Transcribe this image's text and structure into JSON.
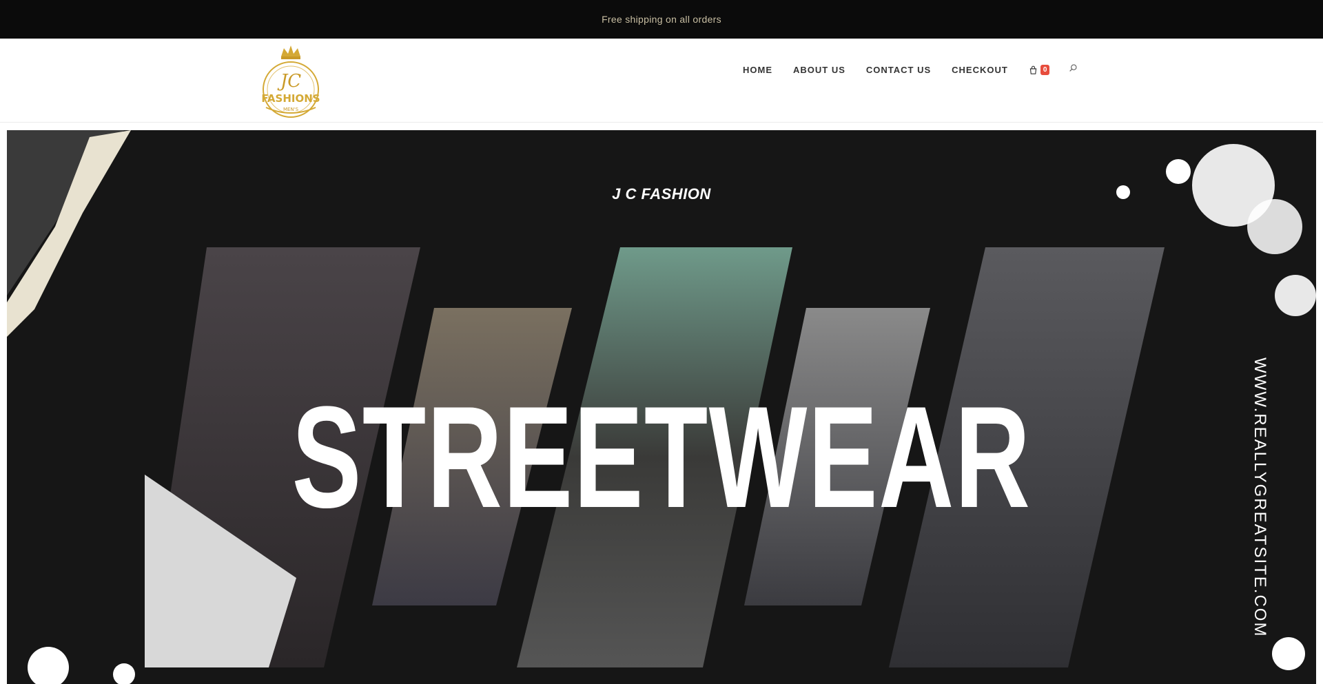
{
  "topbar": {
    "text": "Free shipping on all orders"
  },
  "header": {
    "logo": {
      "main": "FASHIONS",
      "sub": "MEN'S",
      "monogram": "JC"
    },
    "nav": [
      {
        "label": "HOME"
      },
      {
        "label": "ABOUT US"
      },
      {
        "label": "CONTACT US"
      },
      {
        "label": "CHECKOUT"
      }
    ],
    "cart": {
      "icon": "cart-icon",
      "count": "0"
    },
    "search": {
      "icon": "search-icon"
    }
  },
  "hero": {
    "title": "J C FASHION",
    "headline": "STREETWEAR",
    "side_text": "WWW.REALLYGREATSITE.COM"
  },
  "colors": {
    "topbar_bg": "#0b0b0b",
    "topbar_text": "#c9bfa3",
    "badge": "#e74c3c",
    "logo_gold": "#d4a935"
  }
}
